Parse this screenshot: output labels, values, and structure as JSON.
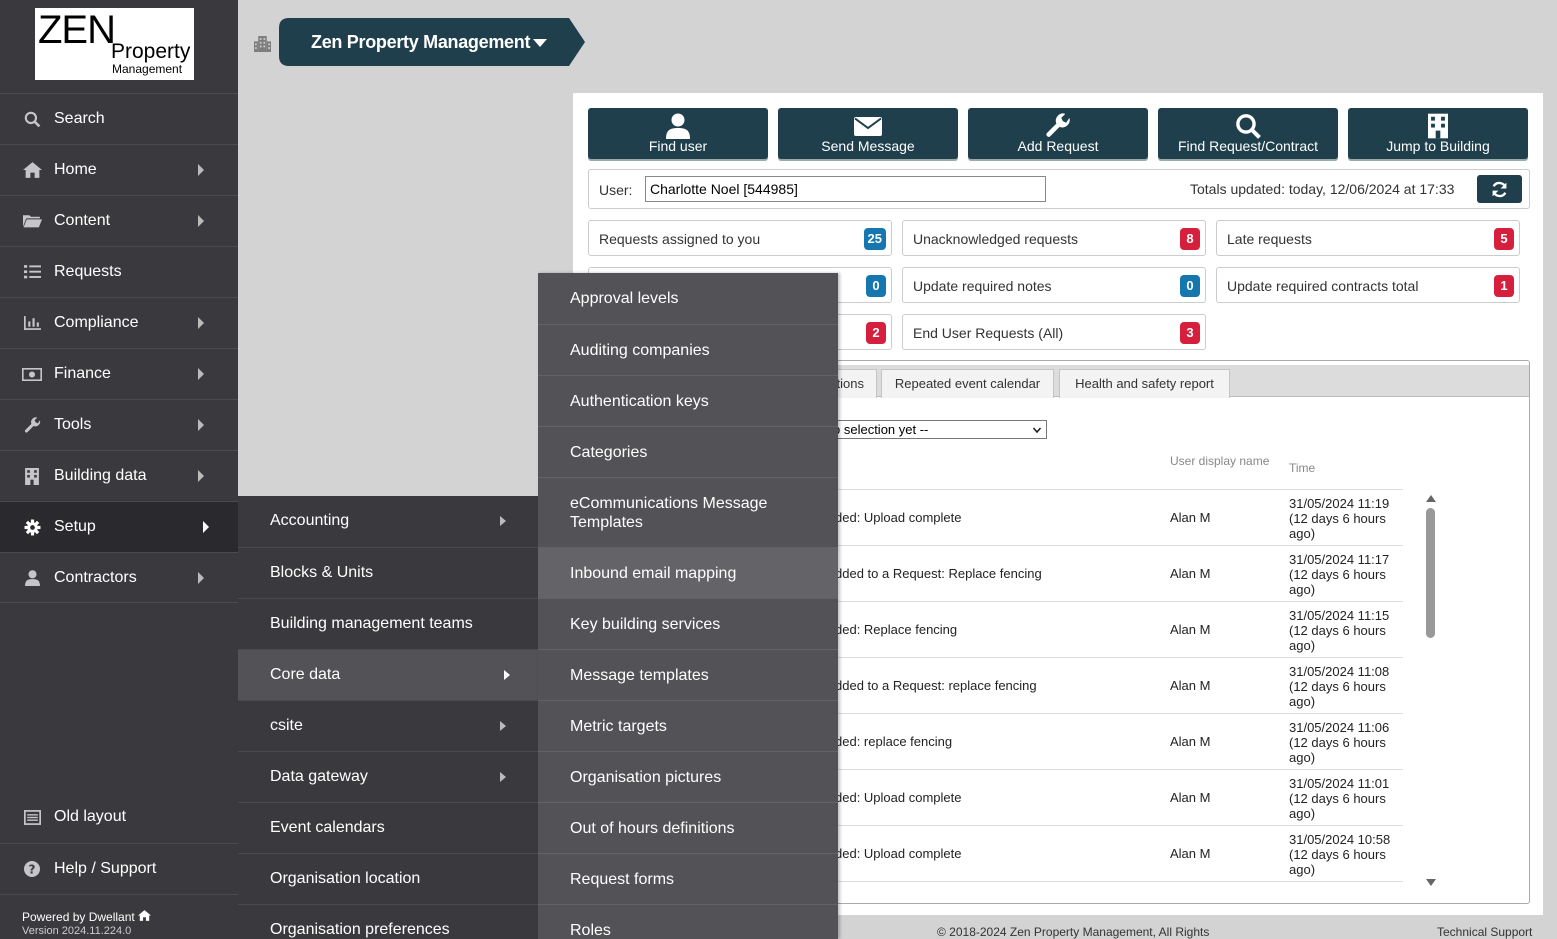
{
  "brand": {
    "logo_top": "ZEN",
    "logo_mid": "Property",
    "logo_bottom": "Management"
  },
  "header": {
    "org_name": "Zen Property Management"
  },
  "sidebar": {
    "items": [
      {
        "label": "Search",
        "icon": "search-icon"
      },
      {
        "label": "Home",
        "icon": "home-icon"
      },
      {
        "label": "Content",
        "icon": "folder-icon"
      },
      {
        "label": "Requests",
        "icon": "list-icon"
      },
      {
        "label": "Compliance",
        "icon": "chart-icon"
      },
      {
        "label": "Finance",
        "icon": "money-icon"
      },
      {
        "label": "Tools",
        "icon": "wrench-icon"
      },
      {
        "label": "Building data",
        "icon": "building-icon"
      },
      {
        "label": "Setup",
        "icon": "gear-icon"
      },
      {
        "label": "Contractors",
        "icon": "user-icon"
      }
    ],
    "bottom_items": [
      {
        "label": "Old layout",
        "icon": "layout-icon"
      },
      {
        "label": "Help / Support",
        "icon": "help-icon"
      }
    ],
    "powered_by": "Powered by Dwellant",
    "version": "Version 2024.11.224.0"
  },
  "toolbar": {
    "find_user": "Find user",
    "send_message": "Send Message",
    "add_request": "Add Request",
    "find_request": "Find Request/Contract",
    "jump_building": "Jump to Building"
  },
  "user_bar": {
    "label": "User:",
    "value": "Charlotte Noel [544985]",
    "totals": "Totals updated: today, 12/06/2024 at 17:33"
  },
  "stats": [
    {
      "label": "Requests assigned to you",
      "count": "25"
    },
    {
      "label": "Unacknowledged requests",
      "count": "8"
    },
    {
      "label": "Late requests",
      "count": "5"
    },
    {
      "label": "",
      "count": "0"
    },
    {
      "label": "Update required notes",
      "count": "0"
    },
    {
      "label": "Update required contracts total",
      "count": "1"
    },
    {
      "label": "",
      "count": "2"
    },
    {
      "label": "End User Requests (All)",
      "count": "3"
    }
  ],
  "tabs": [
    "tions",
    "Repeated event calendar",
    "Health and safety report"
  ],
  "selector": {
    "value": "o selection yet --"
  },
  "table": {
    "col_user": "User display name",
    "col_time": "Time",
    "rows": [
      {
        "desc": "ded: Upload complete",
        "user": "Alan M",
        "time": "31/05/2024 11:19 (12 days 6 hours ago)"
      },
      {
        "desc": "dded to a Request: Replace fencing",
        "user": "Alan M",
        "time": "31/05/2024 11:17 (12 days 6 hours ago)"
      },
      {
        "desc": "ded: Replace fencing",
        "user": "Alan M",
        "time": "31/05/2024 11:15 (12 days 6 hours ago)"
      },
      {
        "desc": "dded to a Request: replace fencing",
        "user": "Alan M",
        "time": "31/05/2024 11:08 (12 days 6 hours ago)"
      },
      {
        "desc": "ded: replace fencing",
        "user": "Alan M",
        "time": "31/05/2024 11:06 (12 days 6 hours ago)"
      },
      {
        "desc": "ded: Upload complete",
        "user": "Alan M",
        "time": "31/05/2024 11:01 (12 days 6 hours ago)"
      },
      {
        "desc": "ded: Upload complete",
        "user": "Alan M",
        "time": "31/05/2024 10:58 (12 days 6 hours ago)"
      }
    ]
  },
  "footer": {
    "copyright": "© 2018-2024 Zen Property Management, All Rights",
    "support": "Technical Support"
  },
  "setup_menu": {
    "items": [
      {
        "label": "Accounting"
      },
      {
        "label": "Blocks & Units"
      },
      {
        "label": "Building management teams"
      },
      {
        "label": "Core data"
      },
      {
        "label": "csite"
      },
      {
        "label": "Data gateway"
      },
      {
        "label": "Event calendars"
      },
      {
        "label": "Organisation location"
      },
      {
        "label": "Organisation preferences"
      }
    ]
  },
  "core_data_menu": {
    "items": [
      {
        "label": "Approval levels"
      },
      {
        "label": "Auditing companies"
      },
      {
        "label": "Authentication keys"
      },
      {
        "label": "Categories"
      },
      {
        "label": "eCommunications Message"
      },
      {
        "label": "Templates"
      },
      {
        "label": "Inbound email mapping"
      },
      {
        "label": "Key building services"
      },
      {
        "label": "Message templates"
      },
      {
        "label": "Metric targets"
      },
      {
        "label": "Organisation pictures"
      },
      {
        "label": "Out of hours definitions"
      },
      {
        "label": "Request forms"
      },
      {
        "label": "Roles"
      }
    ]
  },
  "colors": {
    "primary": "#1e3f4b",
    "sidebar": "#3a3a3e",
    "badge_blue": "#1677b0",
    "badge_red": "#d61f3c"
  }
}
